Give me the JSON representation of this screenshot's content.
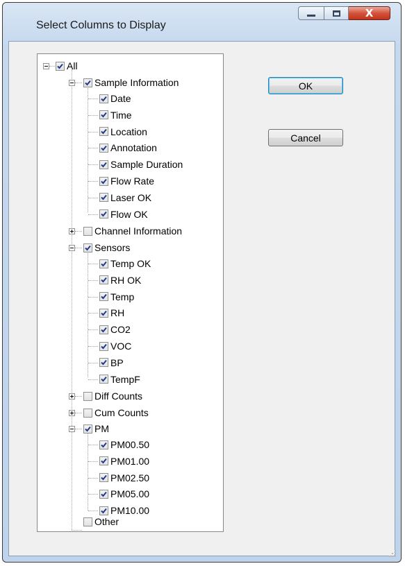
{
  "window": {
    "title": "Select Columns to Display"
  },
  "buttons": {
    "ok": "OK",
    "cancel": "Cancel"
  },
  "tree": {
    "all": {
      "label": "All",
      "checked": true,
      "expanded": true
    },
    "sample_information": {
      "label": "Sample Information",
      "checked": true,
      "expanded": true,
      "children": [
        {
          "label": "Date",
          "checked": true
        },
        {
          "label": "Time",
          "checked": true
        },
        {
          "label": "Location",
          "checked": true
        },
        {
          "label": "Annotation",
          "checked": true
        },
        {
          "label": "Sample Duration",
          "checked": true
        },
        {
          "label": "Flow Rate",
          "checked": true
        },
        {
          "label": "Laser OK",
          "checked": true
        },
        {
          "label": "Flow OK",
          "checked": true
        }
      ]
    },
    "channel_information": {
      "label": "Channel Information",
      "checked": false,
      "expanded": false
    },
    "sensors": {
      "label": "Sensors",
      "checked": true,
      "expanded": true,
      "children": [
        {
          "label": "Temp OK",
          "checked": true
        },
        {
          "label": "RH OK",
          "checked": true
        },
        {
          "label": "Temp",
          "checked": true
        },
        {
          "label": "RH",
          "checked": true
        },
        {
          "label": "CO2",
          "checked": true
        },
        {
          "label": "VOC",
          "checked": true
        },
        {
          "label": "BP",
          "checked": true
        },
        {
          "label": "TempF",
          "checked": true
        }
      ]
    },
    "diff_counts": {
      "label": "Diff Counts",
      "checked": false,
      "expanded": false
    },
    "cum_counts": {
      "label": "Cum Counts",
      "checked": false,
      "expanded": false
    },
    "pm": {
      "label": "PM",
      "checked": true,
      "expanded": true,
      "children": [
        {
          "label": "PM00.50",
          "checked": true
        },
        {
          "label": "PM01.00",
          "checked": true
        },
        {
          "label": "PM02.50",
          "checked": true
        },
        {
          "label": "PM05.00",
          "checked": true
        },
        {
          "label": "PM10.00",
          "checked": true
        }
      ]
    },
    "other": {
      "label": "Other",
      "checked": false
    }
  }
}
